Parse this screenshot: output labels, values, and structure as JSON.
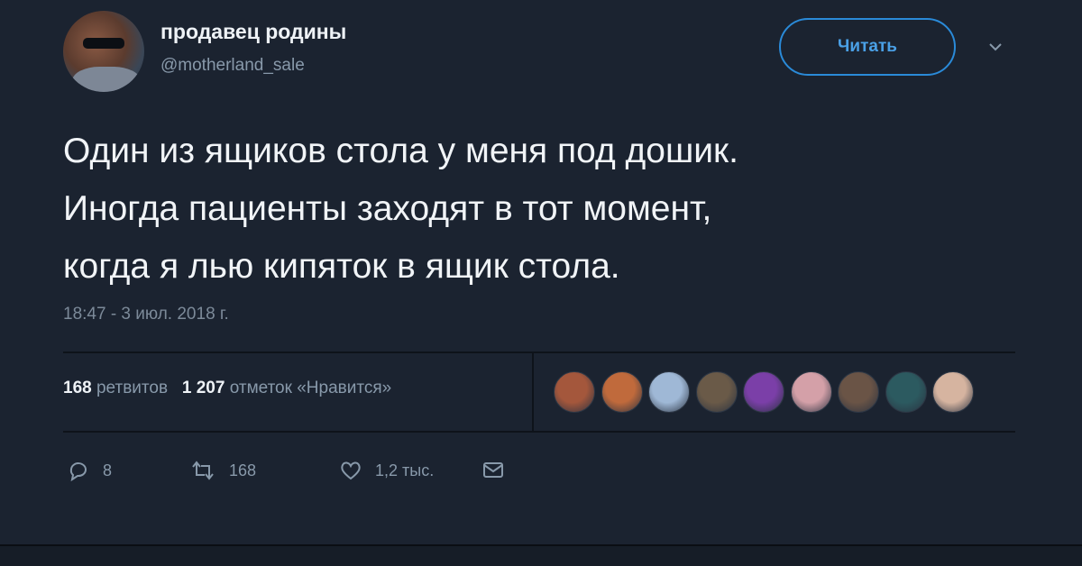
{
  "author": {
    "display_name": "продавец родины",
    "handle": "@motherland_sale"
  },
  "follow_button": {
    "label": "Читать"
  },
  "tweet": {
    "lines": [
      "Один из ящиков стола у меня под дошик.",
      "Иногда пациенты заходят в тот момент,",
      "когда я лью кипяток в ящик стола."
    ],
    "timestamp": "18:47 - 3 июл. 2018 г."
  },
  "stats": {
    "retweets_count": "168",
    "retweets_label": "ретвитов",
    "likes_count": "1 207",
    "likes_label": "отметок «Нравится»"
  },
  "likers": {
    "colors": [
      "#a4573c",
      "#c06a3c",
      "#9fb8d6",
      "#6a5a48",
      "#7b3fa8",
      "#d4a0a8",
      "#6a5446",
      "#2c5a60",
      "#d6b4a0"
    ]
  },
  "actions": {
    "reply_count": "8",
    "retweet_count": "168",
    "like_count": "1,2 тыс."
  }
}
